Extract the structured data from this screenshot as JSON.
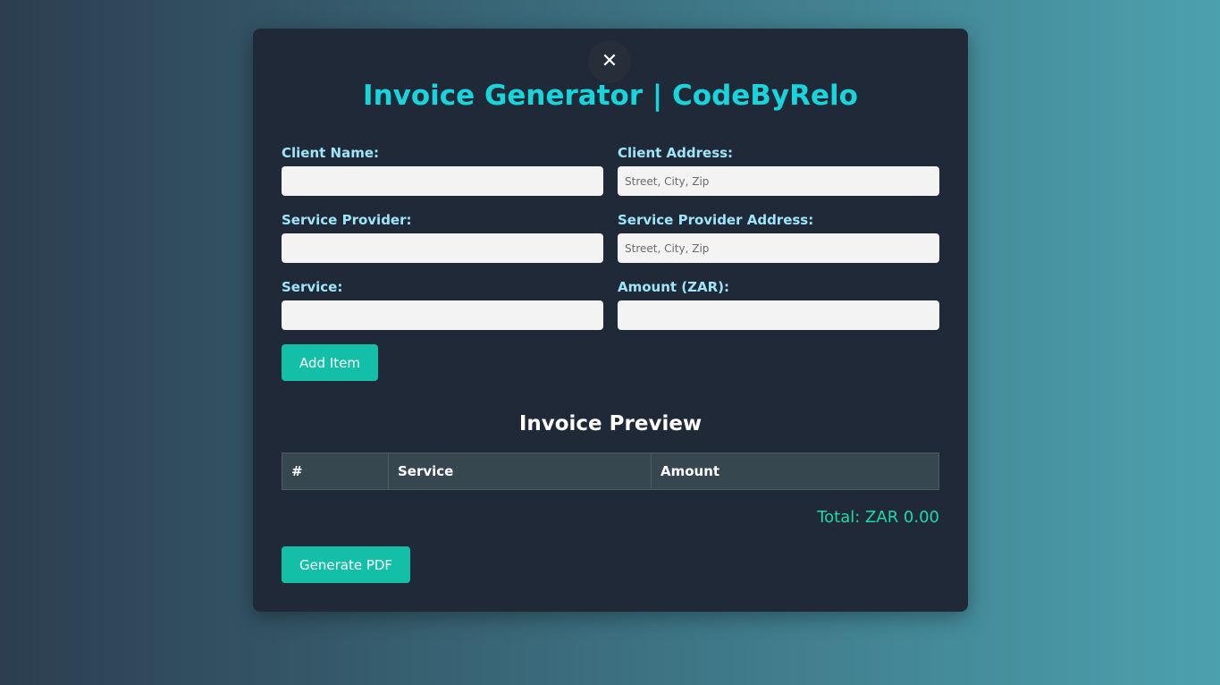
{
  "modal": {
    "close_symbol": "✕",
    "title": "Invoice Generator | CodeByRelo"
  },
  "form": {
    "client_name": {
      "label": "Client Name:",
      "value": "",
      "placeholder": ""
    },
    "client_address": {
      "label": "Client Address:",
      "value": "",
      "placeholder": "Street, City, Zip"
    },
    "service_provider": {
      "label": "Service Provider:",
      "value": "",
      "placeholder": ""
    },
    "service_provider_address": {
      "label": "Service Provider Address:",
      "value": "",
      "placeholder": "Street, City, Zip"
    },
    "service": {
      "label": "Service:",
      "value": "",
      "placeholder": ""
    },
    "amount": {
      "label": "Amount (ZAR):",
      "value": "",
      "placeholder": ""
    },
    "add_item_label": "Add Item"
  },
  "preview": {
    "title": "Invoice Preview",
    "columns": [
      "#",
      "Service",
      "Amount"
    ],
    "rows": [],
    "total_text": "Total: ZAR 0.00"
  },
  "actions": {
    "generate_pdf_label": "Generate PDF"
  },
  "colors": {
    "accent": "#1ad4dc",
    "button": "#13bfa6",
    "total": "#20d8a6",
    "label": "#9fe5f7",
    "card_bg": "#1f2937"
  }
}
